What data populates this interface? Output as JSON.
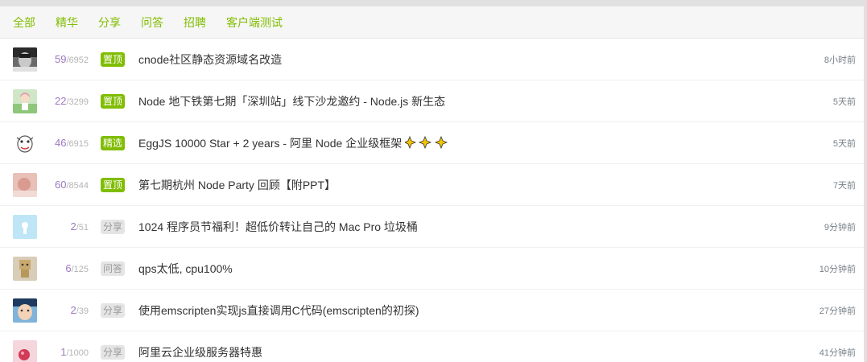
{
  "tabs": [
    "全部",
    "精华",
    "分享",
    "问答",
    "招聘",
    "客户端测试"
  ],
  "colors": {
    "accent": "#80bd01",
    "reply": "#9e78c0",
    "muted": "#b4b4b4",
    "tag_gray": "#e5e5e5"
  },
  "topics": [
    {
      "reply": "59",
      "visit": "6952",
      "tag": "置顶",
      "tag_style": "highlight",
      "title": "cnode社区静态资源域名改造",
      "time": "8小时前",
      "avatar_icon": "user-avatar-dark"
    },
    {
      "reply": "22",
      "visit": "3299",
      "tag": "置顶",
      "tag_style": "highlight",
      "title": "Node 地下铁第七期「深圳站」线下沙龙邀约 - Node.js 新生态",
      "time": "5天前",
      "avatar_icon": "user-avatar-anime"
    },
    {
      "reply": "46",
      "visit": "6915",
      "tag": "精选",
      "tag_style": "highlight",
      "title": "EggJS 10000 Star + 2 years - 阿里 Node 企业级框架",
      "time": "5天前",
      "avatar_icon": "user-avatar-cartoon"
    },
    {
      "reply": "60",
      "visit": "8544",
      "tag": "置顶",
      "tag_style": "highlight",
      "title": "第七期杭州 Node Party 回顾【附PPT】",
      "time": "7天前",
      "avatar_icon": "user-avatar-pink"
    },
    {
      "reply": "2",
      "visit": "51",
      "tag": "分享",
      "tag_style": "gray",
      "title": "1024 程序员节福利！超低价转让自己的 Mac Pro 垃圾桶",
      "time": "9分钟前",
      "avatar_icon": "user-avatar-blue"
    },
    {
      "reply": "6",
      "visit": "125",
      "tag": "问答",
      "tag_style": "gray",
      "title": "qps太低, cpu100%",
      "time": "10分钟前",
      "avatar_icon": "user-avatar-box"
    },
    {
      "reply": "2",
      "visit": "39",
      "tag": "分享",
      "tag_style": "gray",
      "title": "使用emscripten实现js直接调用C代码(emscripten的初探)",
      "time": "27分钟前",
      "avatar_icon": "user-avatar-kid"
    },
    {
      "reply": "1",
      "visit": "1000",
      "tag": "分享",
      "tag_style": "gray",
      "title": "阿里云企业级服务器特惠",
      "time": "41分钟前",
      "avatar_icon": "user-avatar-red"
    }
  ]
}
